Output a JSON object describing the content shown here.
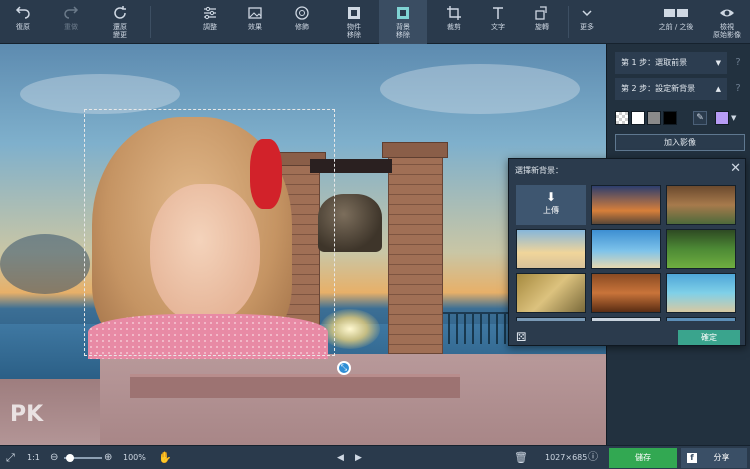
{
  "toolbar": {
    "undo": "復原",
    "redo": "重做",
    "restore": "還原\n變更",
    "adjust": "調整",
    "effects": "效果",
    "retouch": "修飾",
    "object_removal": "物件\n移除",
    "bg_removal": "背景\n移除",
    "crop": "裁剪",
    "text": "文字",
    "rotate": "旋轉",
    "more": "更多",
    "before_after": "之前 / 之後",
    "view_original": "檢視\n原始影像"
  },
  "panel": {
    "step1": "第 1 步：選取前景",
    "step2": "第 2 步：設定新背景",
    "help": "?",
    "add_image": "加入影像",
    "swatch_colors": [
      "#ffffff",
      "#8a8a8a",
      "#000000"
    ],
    "custom_color": "#b79cf5"
  },
  "popup": {
    "title": "選擇新背景：",
    "upload": "上傳",
    "confirm": "確定",
    "close": "✕"
  },
  "bottombar": {
    "zoom_ratio": "1:1",
    "zoom_percent": "100%",
    "dimensions": "1027×685",
    "save": "儲存",
    "share": "分享"
  },
  "watermark": "PK"
}
